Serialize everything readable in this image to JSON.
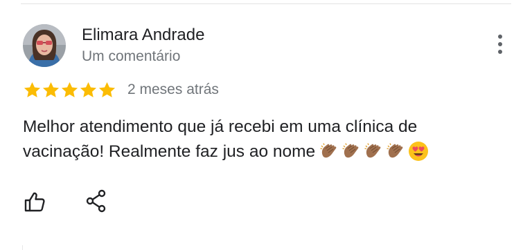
{
  "review": {
    "author_name": "Elimara Andrade",
    "author_meta": "Um comentário",
    "rating": 5,
    "rating_max": 5,
    "date": "2 meses atrás",
    "text": "Melhor atendimento que já recebi em uma clínica de vacinação! Realmente faz jus ao nome",
    "emojis": [
      "clapping-hands-medium-dark",
      "clapping-hands-medium-dark",
      "clapping-hands-medium-dark",
      "clapping-hands-medium-dark",
      "smiling-face-with-heart-eyes"
    ]
  },
  "actions": {
    "like_icon": "thumbs-up-icon",
    "share_icon": "share-icon",
    "more_icon": "more-vert-icon"
  },
  "colors": {
    "star": "#fbbc04",
    "secondary_text": "#70757a",
    "primary_text": "#202124",
    "icon": "#3c4043",
    "clap_skin": "#a0704e"
  }
}
